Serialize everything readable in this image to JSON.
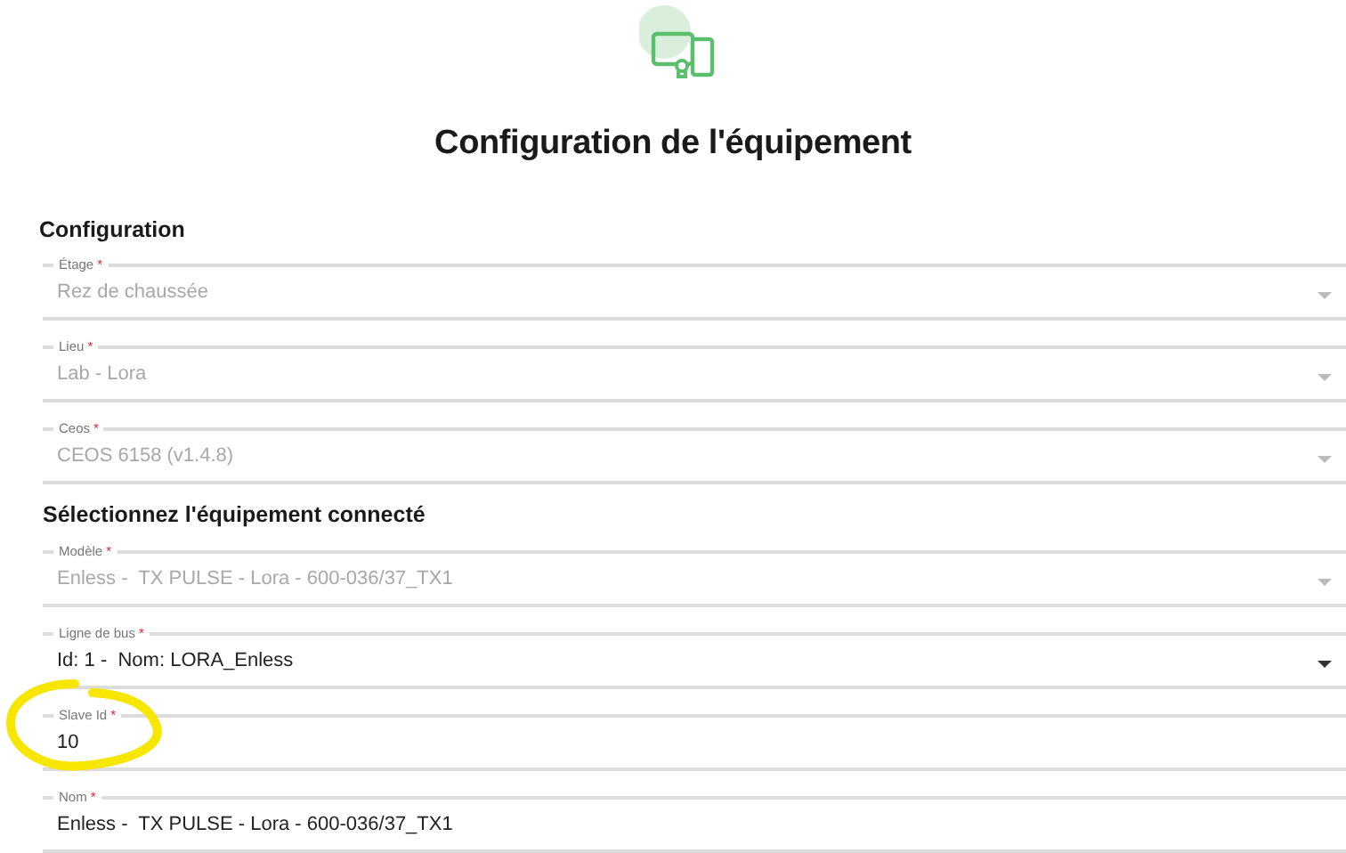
{
  "title": "Configuration de l'équipement",
  "sections": [
    {
      "heading": "Configuration",
      "fields": [
        {
          "kind": "select",
          "label": "Étage",
          "required_mark": "*",
          "value": "Rez de chaussée",
          "disabled": true
        },
        {
          "kind": "select",
          "label": "Lieu",
          "required_mark": "*",
          "value": "Lab - Lora",
          "disabled": true
        },
        {
          "kind": "select",
          "label": "Ceos",
          "required_mark": "*",
          "value": "CEOS 6158 (v1.4.8)",
          "disabled": true
        }
      ]
    },
    {
      "heading": "Sélectionnez l'équipement connecté",
      "fields": [
        {
          "kind": "select",
          "label": "Modèle",
          "required_mark": "*",
          "value": "Enless -  TX PULSE - Lora - 600-036/37_TX1",
          "disabled": true
        },
        {
          "kind": "select",
          "label": "Ligne de bus",
          "required_mark": "*",
          "value": "Id: 1 -  Nom: LORA_Enless",
          "disabled": false
        },
        {
          "kind": "text",
          "label": "Slave Id",
          "required_mark": "*",
          "value": "10",
          "disabled": false
        },
        {
          "kind": "text",
          "label": "Nom",
          "required_mark": "*",
          "value": "Enless -  TX PULSE - Lora - 600-036/37_TX1",
          "disabled": false
        }
      ]
    }
  ]
}
